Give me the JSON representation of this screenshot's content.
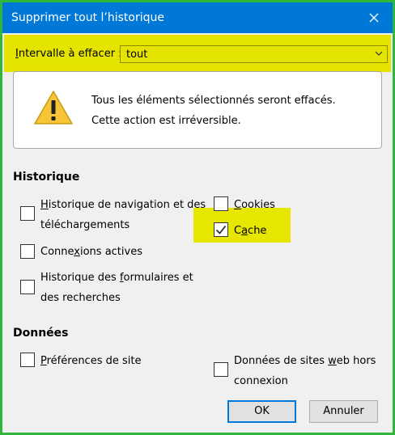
{
  "dialog": {
    "title": "Supprimer tout l’historique",
    "close_icon": "close-icon"
  },
  "range": {
    "label_prefix": "",
    "label_underline": "I",
    "label_rest": "ntervalle à effacer :",
    "value": "tout",
    "arrow_icon": "chevron-down-icon"
  },
  "warning": {
    "icon": "warning-icon",
    "line1": "Tous les éléments sélectionnés seront effacés.",
    "line2": "Cette action est irréversible."
  },
  "history": {
    "title": "Historique",
    "items": [
      {
        "pre": "",
        "u": "H",
        "post": "istorique de navigation et des",
        "line2": "téléchargements",
        "checked": false
      },
      {
        "pre": "Conne",
        "u": "x",
        "post": "ions actives",
        "line2": "",
        "checked": false
      },
      {
        "pre": "Historique des ",
        "u": "f",
        "post": "ormulaires et",
        "line2": "des recherches",
        "checked": false
      },
      {
        "pre": "",
        "u": "C",
        "post": "ookies",
        "line2": "",
        "checked": false
      },
      {
        "pre": "C",
        "u": "a",
        "post": "che",
        "line2": "",
        "checked": true
      }
    ]
  },
  "data": {
    "title": "Données",
    "items": [
      {
        "pre": "",
        "u": "P",
        "post": "références de site",
        "line2": "",
        "checked": false
      },
      {
        "pre": "Données de sites ",
        "u": "w",
        "post": "eb hors",
        "line2": "connexion",
        "checked": false
      }
    ]
  },
  "buttons": {
    "ok": "OK",
    "cancel": "Annuler"
  },
  "colors": {
    "titlebar": "#0078d7",
    "highlight": "#e4e400",
    "border": "#2fb83b"
  }
}
